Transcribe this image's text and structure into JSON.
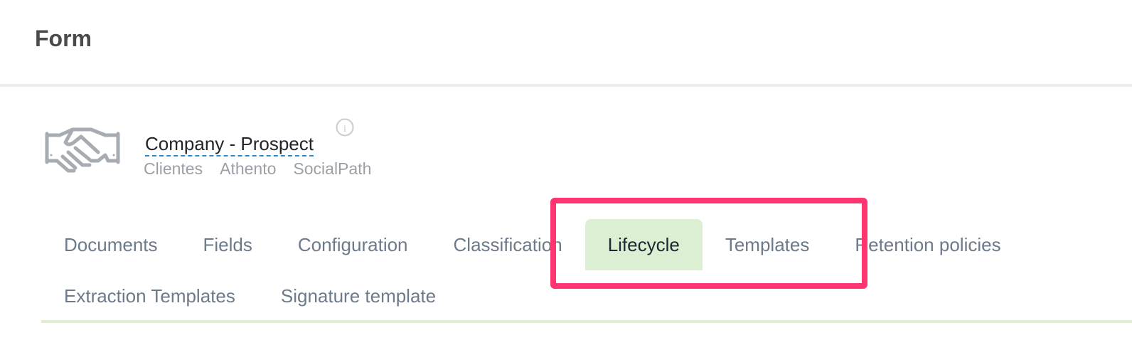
{
  "header": {
    "title": "Form"
  },
  "entity": {
    "icon": "handshake-icon",
    "name": "Company - Prospect",
    "info_icon": "info-icon",
    "tags": [
      "Clientes",
      "Athento",
      "SocialPath"
    ]
  },
  "tabs": {
    "row1": [
      {
        "label": "Documents"
      },
      {
        "label": "Fields"
      },
      {
        "label": "Configuration"
      },
      {
        "label": "Classification"
      },
      {
        "label": "Lifecycle",
        "active": true
      },
      {
        "label": "Templates"
      },
      {
        "label": "Retention policies"
      }
    ],
    "row2": [
      {
        "label": "Extraction Templates"
      },
      {
        "label": "Signature template"
      }
    ]
  },
  "colors": {
    "active_tab_bg": "#dcefd3",
    "highlight": "#ff3571",
    "link_underline": "#2a8dd4"
  }
}
